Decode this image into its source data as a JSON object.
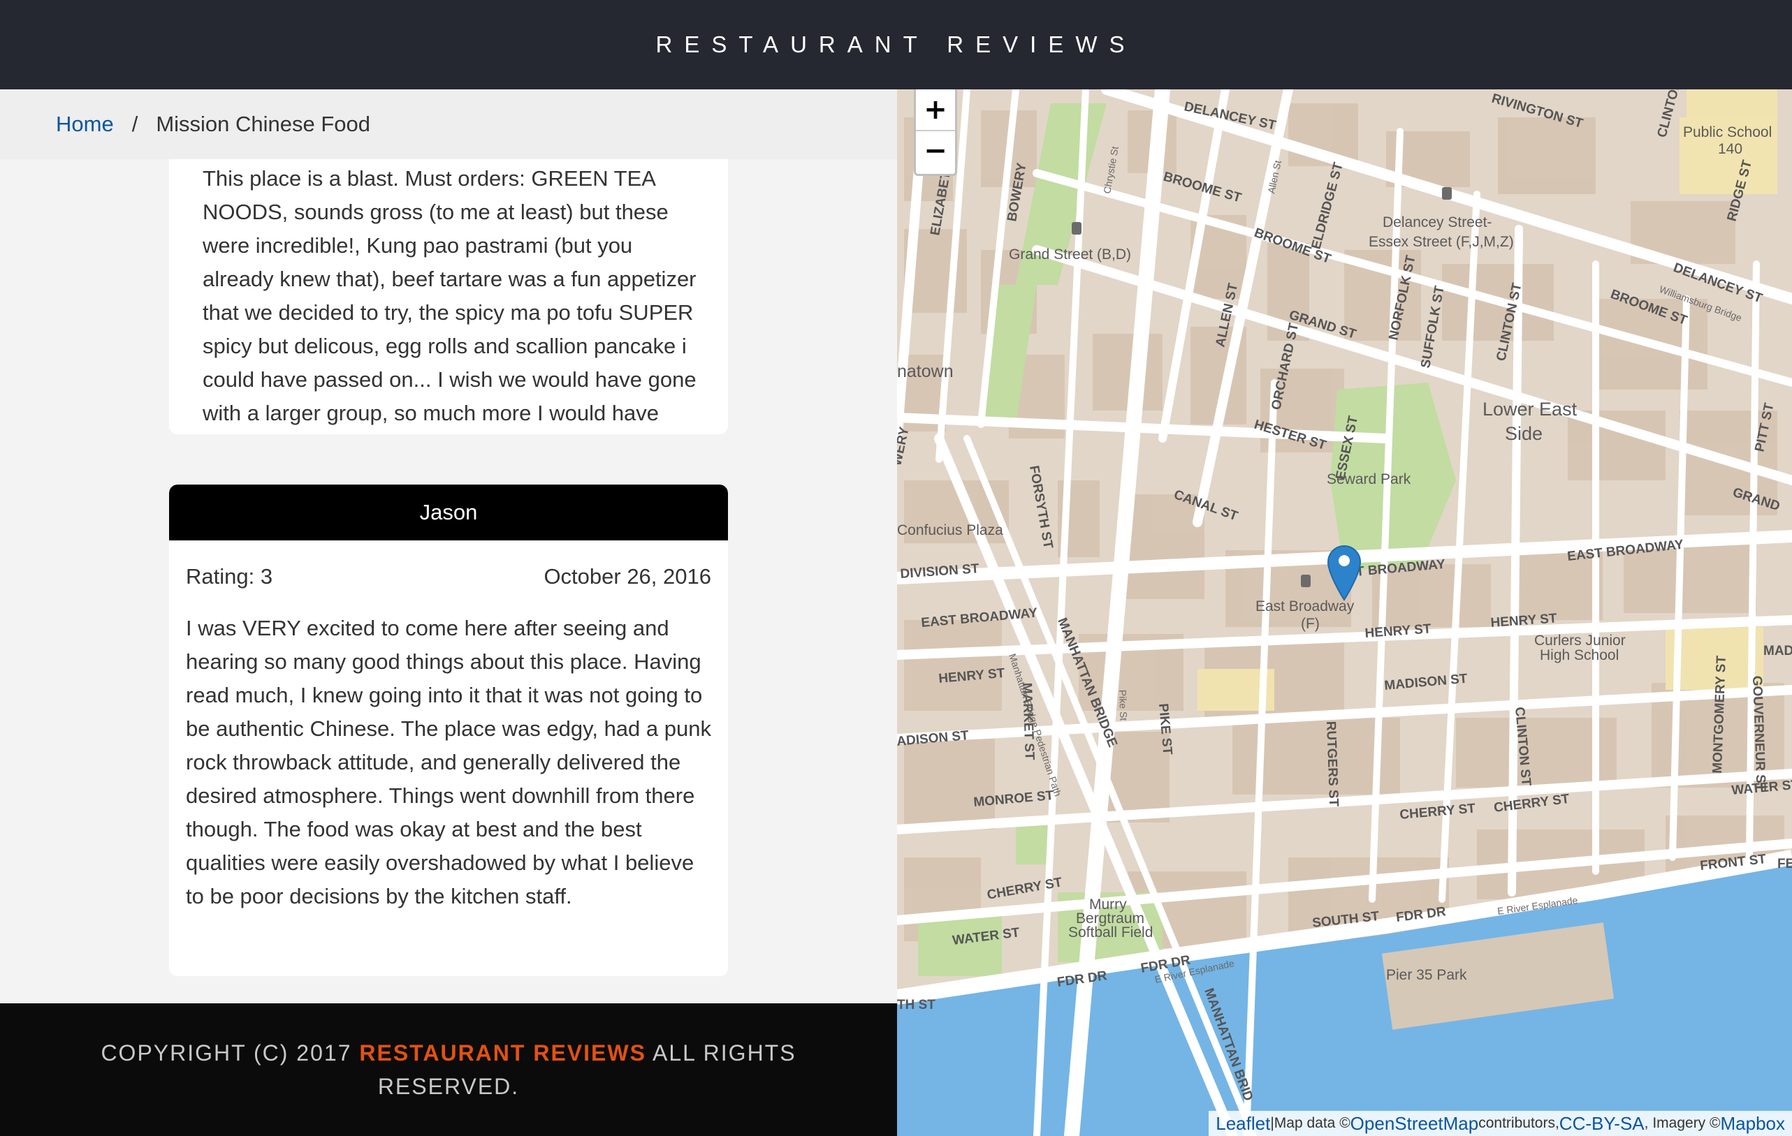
{
  "header": {
    "title": "RESTAURANT REVIEWS"
  },
  "breadcrumb": {
    "home": "Home",
    "separator": "/",
    "current": "Mission Chinese Food"
  },
  "reviews": [
    {
      "text": "This place is a blast. Must orders: GREEN TEA NOODS, sounds gross (to me at least) but these were incredible!, Kung pao pastrami (but you already knew that), beef tartare was a fun appetizer that we decided to try, the spicy ma po tofu SUPER spicy but delicous, egg rolls and scallion pancake i could have passed on... I wish we would have gone with a larger group, so much more I would have liked to try!"
    },
    {
      "name": "Jason",
      "rating": "Rating: 3",
      "date": "October 26, 2016",
      "text": "I was VERY excited to come here after seeing and hearing so many good things about this place. Having read much, I knew going into it that it was not going to be authentic Chinese. The place was edgy, had a punk rock throwback attitude, and generally delivered the desired atmosphere. Things went downhill from there though. The food was okay at best and the best qualities were easily overshadowed by what I believe to be poor decisions by the kitchen staff."
    }
  ],
  "footer": {
    "prefix": "COPYRIGHT (C) 2017 ",
    "brand": "RESTAURANT REVIEWS",
    "suffix": " ALL RIGHTS RESERVED."
  },
  "map": {
    "zoom_in": "+",
    "zoom_out": "−",
    "attribution": {
      "leaflet": "Leaflet",
      "sep": " | ",
      "mapdata": "Map data © ",
      "osm": "OpenStreetMap",
      "contributors": " contributors, ",
      "license": "CC-BY-SA",
      "imagery": ", Imagery © ",
      "mapbox": "Mapbox"
    },
    "labels": {
      "delancey": "DELANCEY ST",
      "rivington": "RIVINGTON ST",
      "clinton_top": "CLINTON",
      "public_school": "Public School",
      "public_school_num": "140",
      "ridge": "RIDGE ST",
      "elizabeth": "ELIZABETH ST",
      "bowery": "BOWERY",
      "chrystie": "Chrystie St",
      "broome1": "BROOME ST",
      "allen_st_small": "Allen St",
      "delancey_station": "Delancey Street-",
      "essex_station": "Essex Street (F,J,M,Z)",
      "broome2": "BROOME ST",
      "grand_station": "Grand Street (B,D)",
      "eldridge": "ELDRIDGE ST",
      "allen": "ALLEN ST",
      "norfolk": "NORFOLK ST",
      "suffolk": "SUFFOLK ST",
      "clinton": "CLINTON ST",
      "williamsburg": "Williamsburg Bridge",
      "delancey2": "DELANCEY ST",
      "broome3": "BROOME ST",
      "grand": "GRAND ST",
      "orchard": "ORCHARD ST",
      "chinatown": "natown",
      "lower_east": "Lower East",
      "side": "Side",
      "pitt": "PITT ST",
      "hester": "HESTER ST",
      "essex": "ESSEX ST",
      "seward": "Seward Park",
      "bowery2": "WERY",
      "forsyth": "FORSYTH ST",
      "canal": "CANAL ST",
      "grand2": "GRAND",
      "confucius": "Confucius Plaza",
      "east_broadway": "EAST BROADWAY",
      "east_broadway2": "ST BROADWAY",
      "division": "DIVISION ST",
      "eb_station": "East Broadway",
      "eb_station_f": "(F)",
      "henry1": "HENRY ST",
      "henry2": "HENRY ST",
      "curlers": "Curlers Junior",
      "high_school": "High School",
      "east_broadway3": "EAST BROADWAY",
      "manhattan_bridge": "MANHATTAN BRIDGE",
      "henry3": "HENRY ST",
      "mbpp": "Manhattan Bridge Pedestrian Path",
      "market": "MARKET ST",
      "pike_small": "Pike St",
      "madison": "MADISON ST",
      "gouverneur": "GOUVERNEUR ST",
      "madi": "MADI",
      "adison": "ADISON ST",
      "rutgers": "RUTGERS ST",
      "clinton2": "CLINTON ST",
      "montgomery": "MONTGOMERY ST",
      "pike": "PIKE ST",
      "monroe": "MONROE ST",
      "cherry1": "CHERRY ST",
      "cherry2": "CHERRY ST",
      "water": "WATER ST",
      "cherry3": "CHERRY ST",
      "murry": "Murry",
      "bergtraum": "Bergtraum",
      "softball": "Softball Field",
      "front": "FRONT ST",
      "water2": "WATER ST",
      "south": "SOUTH ST",
      "fdr1": "FDR DR",
      "river_esplanade": "E River Esplanade",
      "fdr2": "FDR DR",
      "fdr3": "FDR DR",
      "river_esplanade2": "E River Esplanade",
      "pier35": "Pier 35 Park",
      "th_st": "TH ST",
      "fe": "FE",
      "mb2": "MANHATTAN BRID"
    }
  }
}
